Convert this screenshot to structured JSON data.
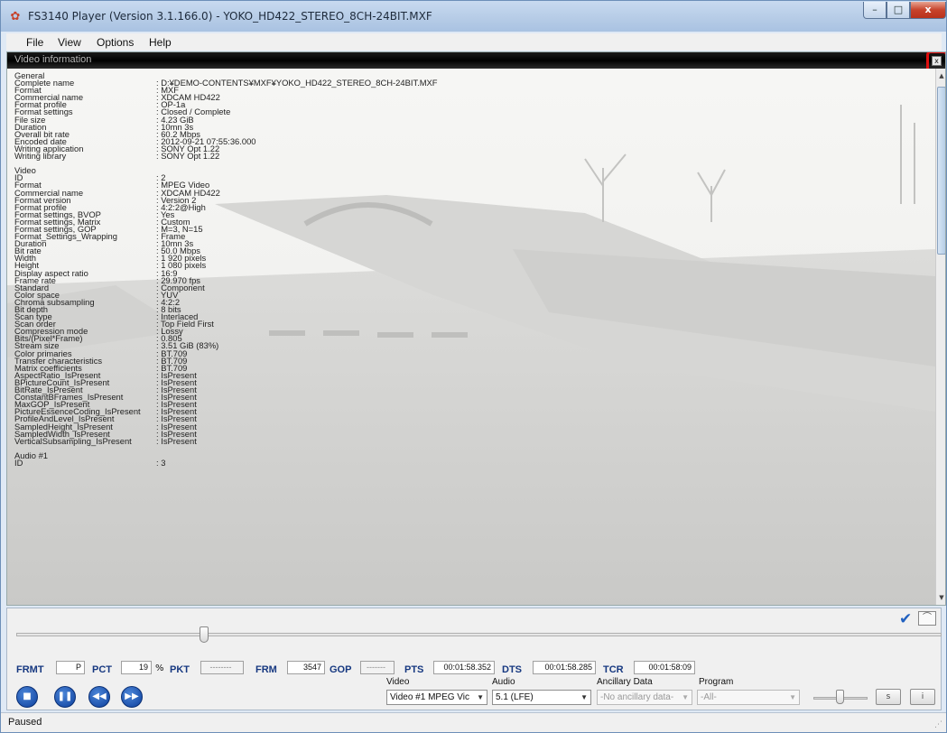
{
  "window": {
    "title": "FS3140 Player (Version 3.1.166.0) - YOKO_HD422_STEREO_8CH-24BIT.MXF",
    "minimize": "–",
    "maximize": "□",
    "close": "x"
  },
  "menu": [
    "File",
    "View",
    "Options",
    "Help"
  ],
  "panel": {
    "title": "Video information",
    "close": "x",
    "sections": [
      {
        "head": "General",
        "rows": [
          [
            "Complete name",
            ": D:¥DEMO-CONTENTS¥MXF¥YOKO_HD422_STEREO_8CH-24BIT.MXF"
          ],
          [
            "Format",
            ": MXF"
          ],
          [
            "Commercial name",
            ": XDCAM HD422"
          ],
          [
            "Format profile",
            ": OP-1a"
          ],
          [
            "Format settings",
            ": Closed / Complete"
          ],
          [
            "File size",
            ": 4.23 GiB"
          ],
          [
            "Duration",
            ": 10mn 3s"
          ],
          [
            "Overall bit rate",
            ": 60.2 Mbps"
          ],
          [
            "Encoded date",
            ": 2012-09-21 07:55:36.000"
          ],
          [
            "Writing application",
            ": SONY Opt  1.22"
          ],
          [
            "Writing library",
            ": SONY Opt  1.22"
          ]
        ]
      },
      {
        "head": "Video",
        "rows": [
          [
            "ID",
            ": 2"
          ],
          [
            "Format",
            ": MPEG Video"
          ],
          [
            "Commercial name",
            ": XDCAM HD422"
          ],
          [
            "Format version",
            ": Version 2"
          ],
          [
            "Format profile",
            ": 4:2:2@High"
          ],
          [
            "Format settings, BVOP",
            ": Yes"
          ],
          [
            "Format settings, Matrix",
            ": Custom"
          ],
          [
            "Format settings, GOP",
            ": M=3, N=15"
          ],
          [
            "Format_Settings_Wrapping",
            ": Frame"
          ],
          [
            "Duration",
            ": 10mn 3s"
          ],
          [
            "Bit rate",
            ": 50.0 Mbps"
          ],
          [
            "Width",
            ": 1 920 pixels"
          ],
          [
            "Height",
            ": 1 080 pixels"
          ],
          [
            "Display aspect ratio",
            ": 16:9"
          ],
          [
            "Frame rate",
            ": 29.970 fps"
          ],
          [
            "Standard",
            ": Component"
          ],
          [
            "Color space",
            ": YUV"
          ],
          [
            "Chroma subsampling",
            ": 4:2:2"
          ],
          [
            "Bit depth",
            ": 8 bits"
          ],
          [
            "Scan type",
            ": Interlaced"
          ],
          [
            "Scan order",
            ": Top Field First"
          ],
          [
            "Compression mode",
            ": Lossy"
          ],
          [
            "Bits/(Pixel*Frame)",
            ": 0.805"
          ],
          [
            "Stream size",
            ": 3.51 GiB (83%)"
          ],
          [
            "Color primaries",
            ": BT.709"
          ],
          [
            "Transfer characteristics",
            ": BT.709"
          ],
          [
            "Matrix coefficients",
            ": BT.709"
          ],
          [
            "AspectRatio_IsPresent",
            ": IsPresent"
          ],
          [
            "BPictureCount_IsPresent",
            ": IsPresent"
          ],
          [
            "BitRate_IsPresent",
            ": IsPresent"
          ],
          [
            "ConstantBFrames_IsPresent",
            ": IsPresent"
          ],
          [
            "MaxGOP_IsPresent",
            ": IsPresent"
          ],
          [
            "PictureEssenceCoding_IsPresent",
            ": IsPresent"
          ],
          [
            "ProfileAndLevel_IsPresent",
            ": IsPresent"
          ],
          [
            "SampledHeight_IsPresent",
            ": IsPresent"
          ],
          [
            "SampledWidth_IsPresent",
            ": IsPresent"
          ],
          [
            "VerticalSubsampling_IsPresent",
            ": IsPresent"
          ]
        ]
      },
      {
        "head": "Audio #1",
        "rows": [
          [
            "ID",
            ": 3"
          ]
        ]
      }
    ]
  },
  "stats": {
    "frmt_label": "FRMT",
    "frmt_value": "P",
    "pct_label": "PCT",
    "pct_value": "19",
    "pct_unit": "%",
    "pkt_label": "PKT",
    "pkt_value": "--------",
    "frm_label": "FRM",
    "frm_value": "3547",
    "gop_label": "GOP",
    "gop_value": "-------",
    "pts_label": "PTS",
    "pts_value": "00:01:58.352",
    "dts_label": "DTS",
    "dts_value": "00:01:58.285",
    "tcr_label": "TCR",
    "tcr_value": "00:01:58:09"
  },
  "selectors": {
    "video_label": "Video",
    "video_value": "Video #1 MPEG Vic",
    "audio_label": "Audio",
    "audio_value": "5.1 (LFE)",
    "anc_label": "Ancillary Data",
    "anc_value": "-No ancillary data-",
    "program_label": "Program",
    "program_value": "-All-"
  },
  "controls": {
    "btn_s": "s",
    "btn_i": "i"
  },
  "playback_position": 0.2,
  "status": {
    "text": "Paused"
  },
  "colors": {
    "accent": "#163880",
    "close_red": "#c7432b",
    "highlight": "#e01010"
  }
}
